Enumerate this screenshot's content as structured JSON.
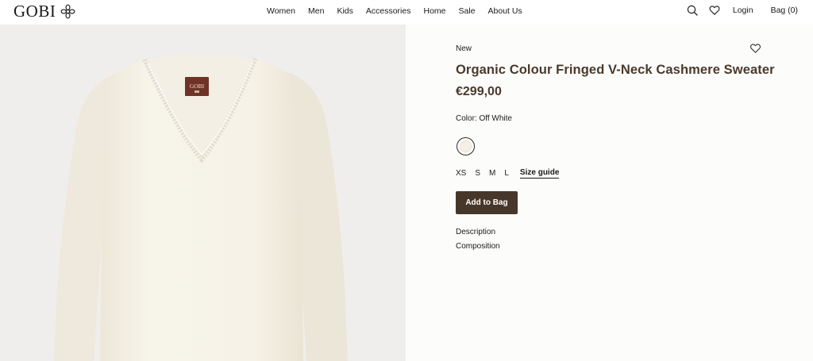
{
  "brand": {
    "name": "GOBI",
    "logo_icon": "flower-emblem-icon"
  },
  "nav": {
    "items": [
      {
        "label": "Women"
      },
      {
        "label": "Men"
      },
      {
        "label": "Kids"
      },
      {
        "label": "Accessories"
      },
      {
        "label": "Home"
      },
      {
        "label": "Sale"
      },
      {
        "label": "About Us"
      }
    ]
  },
  "utility": {
    "search_icon": "search-icon",
    "wishlist_icon": "heart-icon",
    "login_label": "Login",
    "bag_label": "Bag (0)"
  },
  "product": {
    "badge": "New",
    "title": "Organic Colour Fringed V-Neck Cashmere Sweater",
    "price": "€299,00",
    "color_label": "Color: Off White",
    "swatch_color": "#f4f0e4",
    "sizes": [
      "XS",
      "S",
      "M",
      "L"
    ],
    "size_guide_label": "Size guide",
    "add_to_bag_label": "Add to Bag",
    "accordions": [
      {
        "label": "Description"
      },
      {
        "label": "Composition"
      }
    ],
    "image": {
      "garment_tag_text": "GOBI",
      "background": "#efeeec",
      "garment_color": "#f7f4ea"
    }
  },
  "colors": {
    "accent": "#47372b",
    "title_color": "#4a3a2c"
  }
}
